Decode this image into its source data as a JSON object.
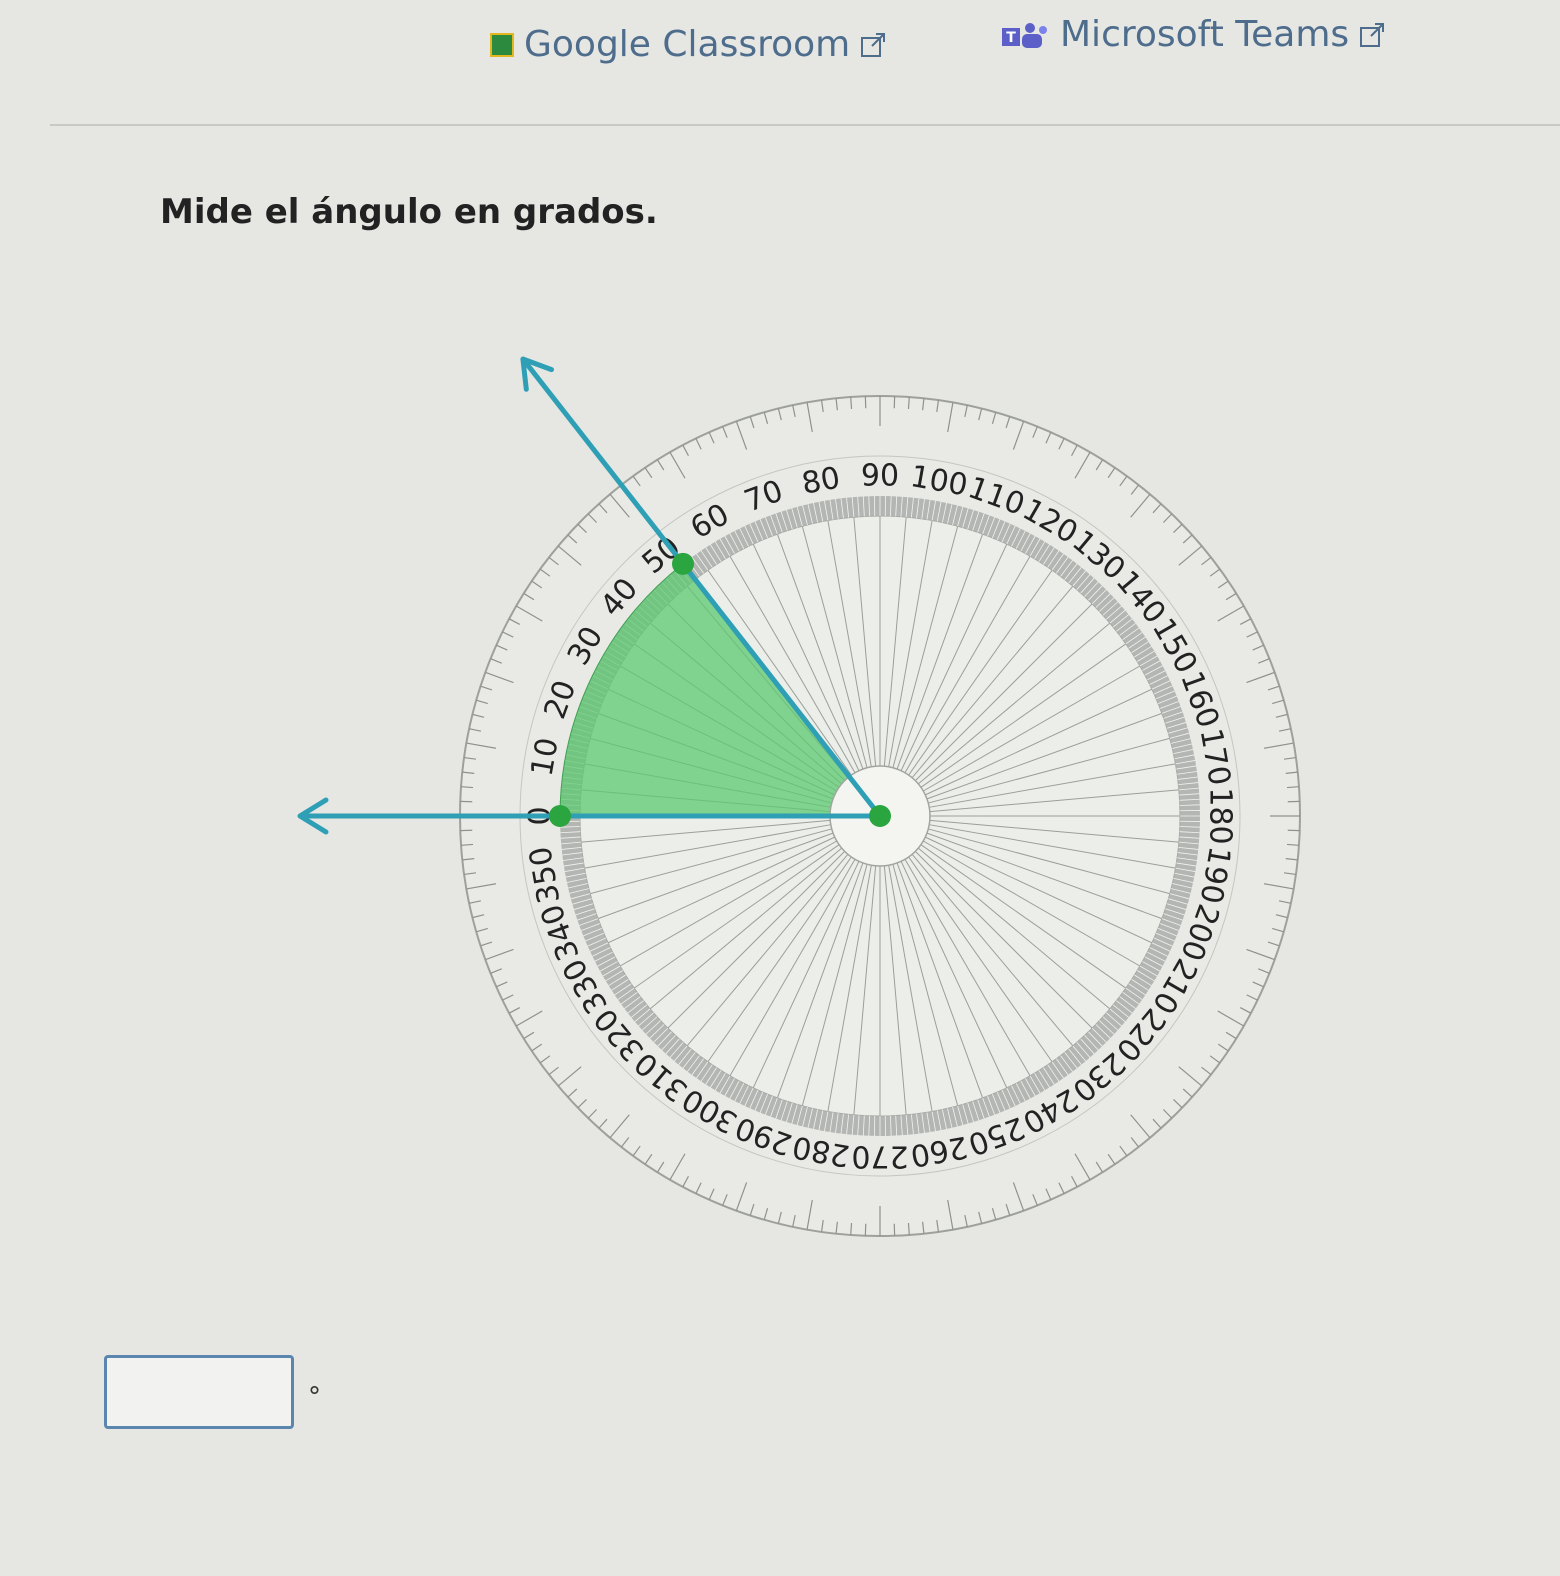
{
  "links": {
    "classroom": "Google Classroom",
    "teams": "Microsoft Teams"
  },
  "question": "Mide el ángulo en grados.",
  "protractor": {
    "scale_labels": [
      "0",
      "10",
      "20",
      "30",
      "40",
      "50",
      "60",
      "70",
      "80",
      "90",
      "100",
      "110",
      "120",
      "130",
      "140",
      "150",
      "160",
      "170",
      "180",
      "190",
      "200",
      "210",
      "220",
      "230",
      "240",
      "250",
      "260",
      "270",
      "280",
      "290",
      "300",
      "310",
      "320",
      "330",
      "340",
      "350"
    ],
    "ray_a_reading": 0,
    "ray_b_reading": 52,
    "colors": {
      "ray": "#2e9fb5",
      "sector": "#5cc870",
      "point": "#2aa53f",
      "ring": "#b4b6b3"
    }
  },
  "answer": {
    "value": "",
    "unit": "°"
  }
}
